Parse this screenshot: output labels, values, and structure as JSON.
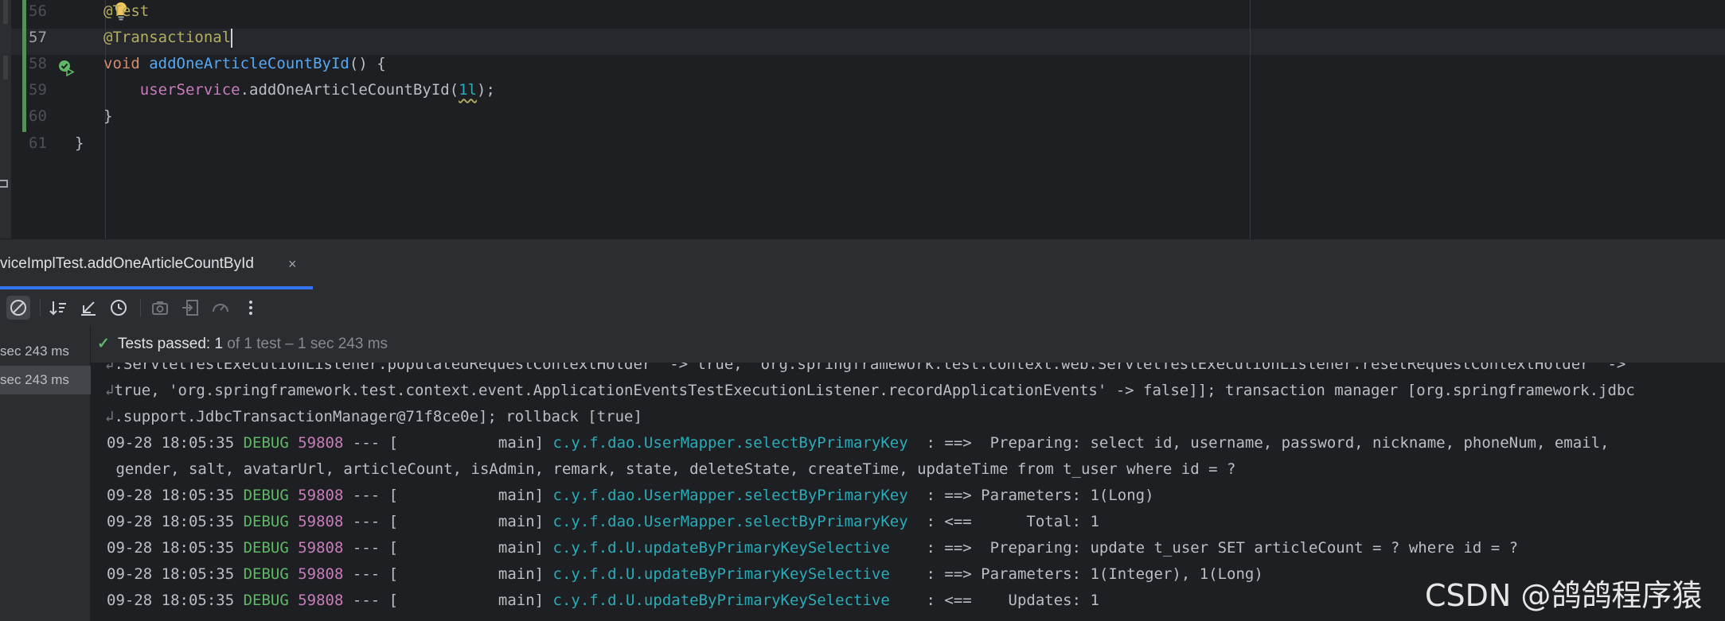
{
  "editor": {
    "lines": [
      {
        "n": "56",
        "parts": [
          {
            "t": "@Test",
            "c": "ann"
          }
        ]
      },
      {
        "n": "57",
        "parts": [
          {
            "t": "@Transactional",
            "c": "ann"
          }
        ]
      },
      {
        "n": "58",
        "parts": [
          {
            "t": "void ",
            "c": "kw"
          },
          {
            "t": "addOneArticleCountById",
            "c": "fn"
          },
          {
            "t": "() {",
            "c": ""
          }
        ]
      },
      {
        "n": "59",
        "parts": [
          {
            "t": "    ",
            "c": ""
          },
          {
            "t": "userService",
            "c": "fld"
          },
          {
            "t": ".addOneArticleCountById(",
            "c": ""
          },
          {
            "t": "1l",
            "c": "num"
          },
          {
            "t": ");",
            "c": ""
          }
        ]
      },
      {
        "n": "60",
        "parts": [
          {
            "t": "}",
            "c": ""
          }
        ]
      },
      {
        "n": "61",
        "parts": [
          {
            "t": "}",
            "c": ""
          }
        ]
      }
    ],
    "current_line": "57"
  },
  "run_window": {
    "tab_title": "viceImplTest.addOneArticleCountById",
    "tab_close": "×",
    "status_check": "✓",
    "status_passed": "Tests passed: ",
    "status_count": "1",
    "status_detail": " of 1 test – 1 sec 243 ms",
    "tree": [
      {
        "label": "sec 243 ms",
        "selected": false
      },
      {
        "label": "sec 243 ms",
        "selected": true
      }
    ]
  },
  "console": {
    "wrap_lines": [
      ".ServletTestExecutionListener.populatedRequestContextHolder' -> true, 'org.springframework.test.context.web.ServletTestExecutionListener.resetRequestContextHolder' -> ",
      "true, 'org.springframework.test.context.event.ApplicationEventsTestExecutionListener.recordApplicationEvents' -> false]]; transaction manager [org.springframework.jdbc",
      ".support.JdbcTransactionManager@71f8ce0e]; rollback [true]"
    ],
    "log_lines": [
      {
        "ts": "09-28 18:05:35 ",
        "level": "DEBUG",
        "pid": " 59808",
        "sep": " --- [           main] ",
        "logger": "c.y.f.dao.UserMapper.selectByPrimaryKey ",
        "msg": " : ==>  Preparing: select id, username, password, nickname, phoneNum, email,"
      },
      {
        "cont": " gender, salt, avatarUrl, articleCount, isAdmin, remark, state, deleteState, createTime, updateTime from t_user where id = ?"
      },
      {
        "ts": "09-28 18:05:35 ",
        "level": "DEBUG",
        "pid": " 59808",
        "sep": " --- [           main] ",
        "logger": "c.y.f.dao.UserMapper.selectByPrimaryKey ",
        "msg": " : ==> Parameters: 1(Long)"
      },
      {
        "ts": "09-28 18:05:35 ",
        "level": "DEBUG",
        "pid": " 59808",
        "sep": " --- [           main] ",
        "logger": "c.y.f.dao.UserMapper.selectByPrimaryKey ",
        "msg": " : <==      Total: 1"
      },
      {
        "ts": "09-28 18:05:35 ",
        "level": "DEBUG",
        "pid": " 59808",
        "sep": " --- [           main] ",
        "logger": "c.y.f.d.U.updateByPrimaryKeySelective   ",
        "msg": " : ==>  Preparing: update t_user SET articleCount = ? where id = ?"
      },
      {
        "ts": "09-28 18:05:35 ",
        "level": "DEBUG",
        "pid": " 59808",
        "sep": " --- [           main] ",
        "logger": "c.y.f.d.U.updateByPrimaryKeySelective   ",
        "msg": " : ==> Parameters: 1(Integer), 1(Long)"
      },
      {
        "ts": "09-28 18:05:35 ",
        "level": "DEBUG",
        "pid": " 59808",
        "sep": " --- [           main] ",
        "logger": "c.y.f.d.U.updateByPrimaryKeySelective   ",
        "msg": " : <==    Updates: 1"
      }
    ]
  },
  "watermark": "CSDN @鸽鸽程序猿",
  "colors": {
    "accent": "#3574f0",
    "pass": "#5fb865",
    "annotation": "#b3ae60",
    "keyword": "#cf8e6d",
    "function": "#56a8f5",
    "field": "#c77dbb",
    "number": "#2aacb8"
  },
  "icons": [
    "lightbulb-icon",
    "run-gutter-icon",
    "stop-icon",
    "sort-icon",
    "collapse-icon",
    "history-icon",
    "camera-icon",
    "import-icon",
    "speed-icon",
    "more-icon",
    "check-icon",
    "folder-icon"
  ]
}
